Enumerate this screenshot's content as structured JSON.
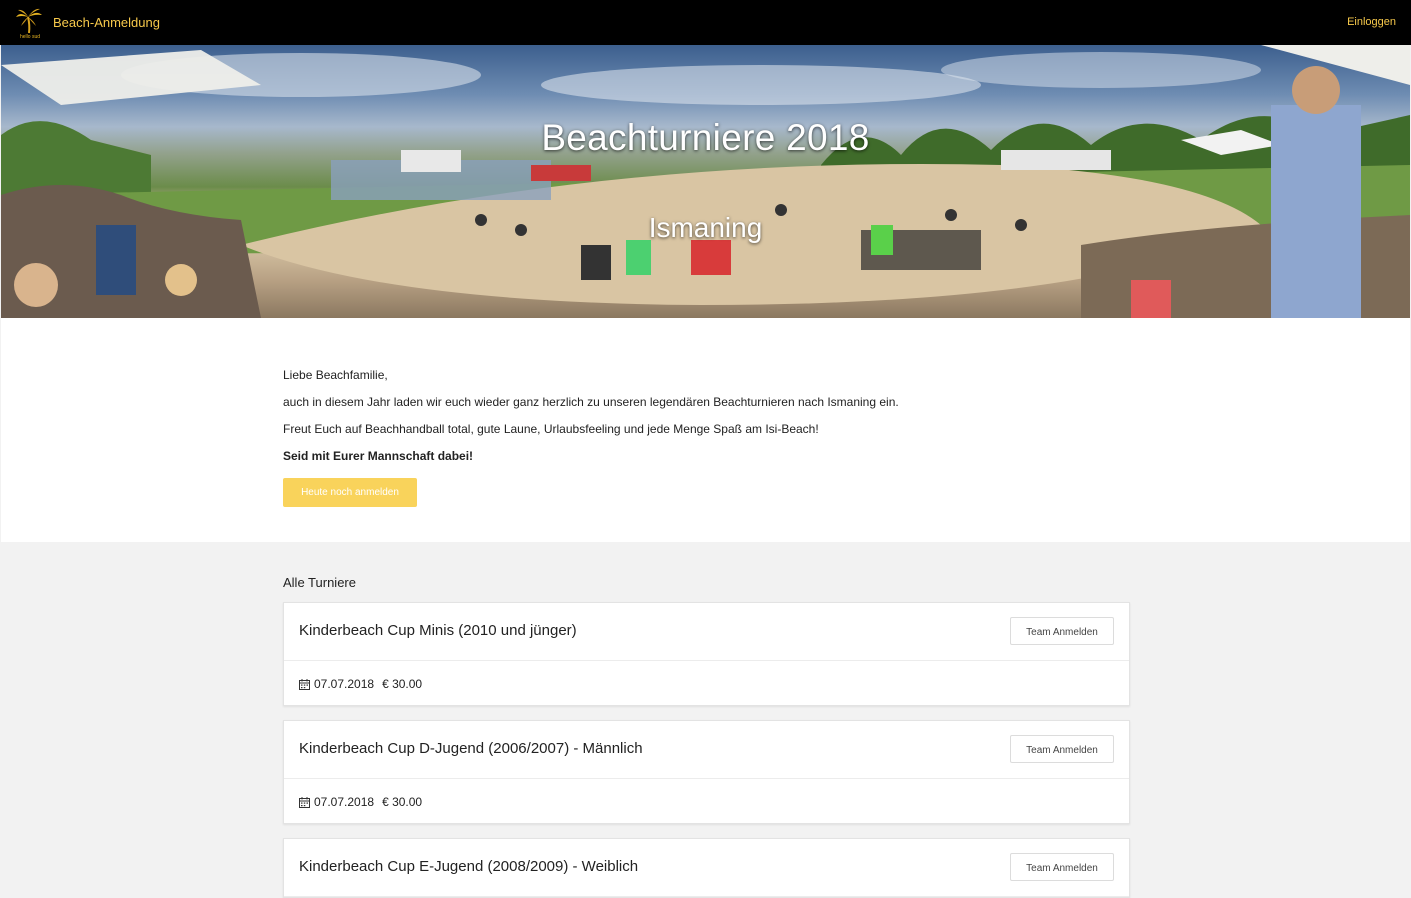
{
  "nav": {
    "brand_label": "Beach-Anmeldung",
    "login_label": "Einloggen",
    "logo_icon": "palm-tree-logo-icon",
    "accent_color": "#f7c94b"
  },
  "hero": {
    "title": "Beachturniere 2018",
    "subtitle": "Ismaning"
  },
  "intro": {
    "greeting": "Liebe Beachfamilie,",
    "line1": "auch in diesem Jahr laden wir euch wieder ganz herzlich zu unseren legendären Beachturnieren nach Ismaning ein.",
    "line2": "Freut Euch auf Beachhandball total, gute Laune, Urlaubsfeeling und jede Menge Spaß am Isi-Beach!",
    "line3": "Seid mit Eurer Mannschaft dabei!",
    "cta_label": "Heute noch anmelden",
    "cta_color": "#f9d35b"
  },
  "list": {
    "heading": "Alle Turniere",
    "items": [
      {
        "title": "Kinderbeach Cup Minis (2010 und jünger)",
        "button": "Team Anmelden",
        "date": "07.07.2018",
        "price": "€ 30.00"
      },
      {
        "title": "Kinderbeach Cup D-Jugend (2006/2007) - Männlich",
        "button": "Team Anmelden",
        "date": "07.07.2018",
        "price": "€ 30.00"
      },
      {
        "title": "Kinderbeach Cup E-Jugend (2008/2009) - Weiblich",
        "button": "Team Anmelden",
        "date": "",
        "price": ""
      }
    ]
  }
}
